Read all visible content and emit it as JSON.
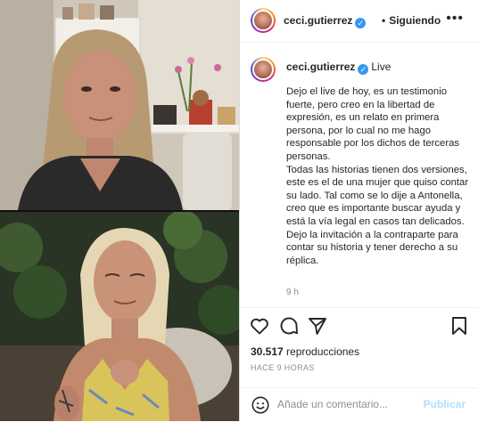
{
  "header": {
    "username": "ceci.gutierrez",
    "separator": "•",
    "follow_label": "Siguiendo",
    "more_icon": "more-horizontal-icon"
  },
  "post": {
    "username": "ceci.gutierrez",
    "live_label": "Live",
    "caption": [
      "Dejo el live de hoy, es un testimonio fuerte, pero creo en la libertad de expresión, es un relato en primera persona, por lo cual no me hago responsable por los dichos de terceras personas.",
      "Todas las historias tienen dos versiones, este es el de una mujer que quiso contar su lado. Tal como se lo dije a Antonella, creo que es importante buscar ayuda y está la vía legal en casos tan delicados.",
      "Dejo la invitación a la contraparte para contar su historia y tener derecho a su réplica."
    ],
    "time_short": "9 h"
  },
  "actions": {
    "icons": [
      "heart-icon",
      "comment-icon",
      "share-icon",
      "bookmark-icon"
    ]
  },
  "stats": {
    "count": "30.517",
    "label": "reproducciones"
  },
  "time_ago": "HACE 9 HORAS",
  "comment": {
    "placeholder": "Añade un comentario...",
    "publish_label": "Publicar",
    "emoji_icon": "emoji-icon"
  },
  "colors": {
    "verified": "#3897f0",
    "publish_disabled": "#b2dffc",
    "secondary_text": "#8e8e8e"
  }
}
